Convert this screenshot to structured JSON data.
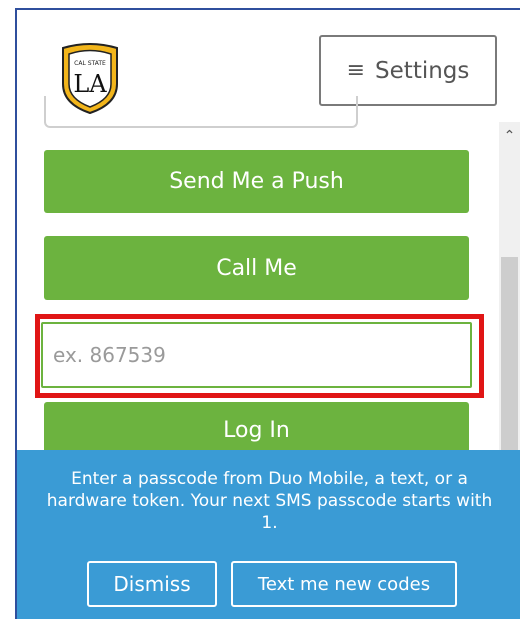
{
  "header": {
    "logo": {
      "top_text": "CAL STATE",
      "main_text": "LA"
    },
    "settings": {
      "icon": "hamburger-icon",
      "label": "Settings"
    }
  },
  "auth": {
    "push_label": "Send Me a Push",
    "call_label": "Call Me",
    "passcode_placeholder": "ex. 867539",
    "login_label": "Log In"
  },
  "banner": {
    "message": "Enter a passcode from Duo Mobile, a text, or a hardware token. Your next SMS passcode starts with 1.",
    "dismiss_label": "Dismiss",
    "text_codes_label": "Text me new codes"
  },
  "colors": {
    "accent_green": "#6cb33f",
    "banner_blue": "#3a9bd5",
    "highlight_red": "#e01515",
    "logo_gold": "#f2b51b"
  }
}
